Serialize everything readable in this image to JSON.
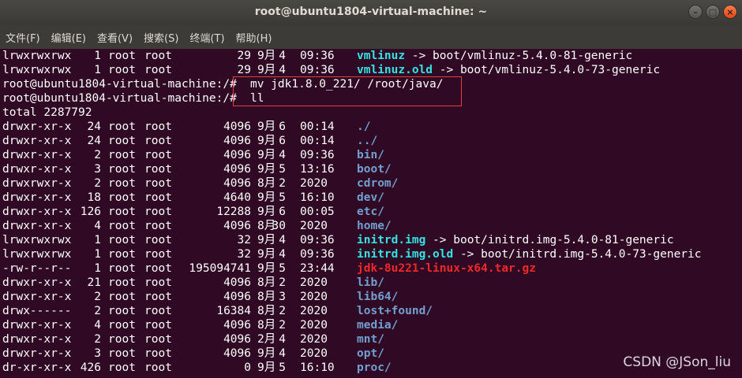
{
  "window": {
    "title": "root@ubuntu1804-virtual-machine: ~"
  },
  "menu": [
    "文件(F)",
    "编辑(E)",
    "查看(V)",
    "搜索(S)",
    "终端(T)",
    "帮助(H)"
  ],
  "rows": [
    {
      "perm": "lrwxrwxrwx",
      "links": "1",
      "user": "root",
      "group": "root",
      "size": "29",
      "month": "9月",
      "day": "4",
      "time": "09:36",
      "name": "vmlinuz",
      "link": " -> boot/vmlinuz-5.4.0-81-generic",
      "color": "cyan"
    },
    {
      "perm": "lrwxrwxrwx",
      "links": "1",
      "user": "root",
      "group": "root",
      "size": "29",
      "month": "9月",
      "day": "4",
      "time": "09:36",
      "name": "vmlinuz.old",
      "link": " -> boot/vmlinuz-5.4.0-73-generic",
      "color": "cyan"
    },
    {
      "prompt": "root@ubuntu1804-virtual-machine:/# ",
      "cmd": "mv jdk1.8.0_221/ /root/java/"
    },
    {
      "prompt": "root@ubuntu1804-virtual-machine:/# ",
      "cmd": "ll"
    },
    {
      "text": "total 2287792"
    },
    {
      "perm": "drwxr-xr-x",
      "links": "24",
      "user": "root",
      "group": "root",
      "size": "4096",
      "month": "9月",
      "day": "6",
      "time": "00:14",
      "name": "./",
      "color": "blue"
    },
    {
      "perm": "drwxr-xr-x",
      "links": "24",
      "user": "root",
      "group": "root",
      "size": "4096",
      "month": "9月",
      "day": "6",
      "time": "00:14",
      "name": "../",
      "color": "blue"
    },
    {
      "perm": "drwxr-xr-x",
      "links": "2",
      "user": "root",
      "group": "root",
      "size": "4096",
      "month": "9月",
      "day": "4",
      "time": "09:36",
      "name": "bin/",
      "color": "blue"
    },
    {
      "perm": "drwxr-xr-x",
      "links": "3",
      "user": "root",
      "group": "root",
      "size": "4096",
      "month": "9月",
      "day": "5",
      "time": "13:16",
      "name": "boot/",
      "color": "blue"
    },
    {
      "perm": "drwxrwxr-x",
      "links": "2",
      "user": "root",
      "group": "root",
      "size": "4096",
      "month": "8月",
      "day": "2",
      "time": "2020",
      "name": "cdrom/",
      "color": "blue"
    },
    {
      "perm": "drwxr-xr-x",
      "links": "18",
      "user": "root",
      "group": "root",
      "size": "4640",
      "month": "9月",
      "day": "5",
      "time": "16:10",
      "name": "dev/",
      "color": "blue"
    },
    {
      "perm": "drwxr-xr-x",
      "links": "126",
      "user": "root",
      "group": "root",
      "size": "12288",
      "month": "9月",
      "day": "6",
      "time": "00:05",
      "name": "etc/",
      "color": "blue"
    },
    {
      "perm": "drwxr-xr-x",
      "links": "4",
      "user": "root",
      "group": "root",
      "size": "4096",
      "month": "8月",
      "day": "30",
      "time": "2020",
      "name": "home/",
      "color": "blue"
    },
    {
      "perm": "lrwxrwxrwx",
      "links": "1",
      "user": "root",
      "group": "root",
      "size": "32",
      "month": "9月",
      "day": "4",
      "time": "09:36",
      "name": "initrd.img",
      "link": " -> boot/initrd.img-5.4.0-81-generic",
      "color": "cyan"
    },
    {
      "perm": "lrwxrwxrwx",
      "links": "1",
      "user": "root",
      "group": "root",
      "size": "32",
      "month": "9月",
      "day": "4",
      "time": "09:36",
      "name": "initrd.img.old",
      "link": " -> boot/initrd.img-5.4.0-73-generic",
      "color": "cyan"
    },
    {
      "perm": "-rw-r--r--",
      "links": "1",
      "user": "root",
      "group": "root",
      "size": "195094741",
      "month": "9月",
      "day": "5",
      "time": "23:44",
      "name": "jdk-8u221-linux-x64.tar.gz",
      "color": "red"
    },
    {
      "perm": "drwxr-xr-x",
      "links": "21",
      "user": "root",
      "group": "root",
      "size": "4096",
      "month": "8月",
      "day": "2",
      "time": "2020",
      "name": "lib/",
      "color": "blue"
    },
    {
      "perm": "drwxr-xr-x",
      "links": "2",
      "user": "root",
      "group": "root",
      "size": "4096",
      "month": "8月",
      "day": "3",
      "time": "2020",
      "name": "lib64/",
      "color": "blue"
    },
    {
      "perm": "drwx------",
      "links": "2",
      "user": "root",
      "group": "root",
      "size": "16384",
      "month": "8月",
      "day": "2",
      "time": "2020",
      "name": "lost+found/",
      "color": "blue"
    },
    {
      "perm": "drwxr-xr-x",
      "links": "4",
      "user": "root",
      "group": "root",
      "size": "4096",
      "month": "8月",
      "day": "2",
      "time": "2020",
      "name": "media/",
      "color": "blue"
    },
    {
      "perm": "drwxr-xr-x",
      "links": "2",
      "user": "root",
      "group": "root",
      "size": "4096",
      "month": "2月",
      "day": "4",
      "time": "2020",
      "name": "mnt/",
      "color": "blue"
    },
    {
      "perm": "drwxr-xr-x",
      "links": "3",
      "user": "root",
      "group": "root",
      "size": "4096",
      "month": "9月",
      "day": "4",
      "time": "2020",
      "name": "opt/",
      "color": "blue"
    },
    {
      "perm": "dr-xr-xr-x",
      "links": "426",
      "user": "root",
      "group": "root",
      "size": "0",
      "month": "9月",
      "day": "5",
      "time": "16:10",
      "name": "proc/",
      "color": "blue"
    }
  ],
  "watermark": "CSDN @JSon_liu",
  "colors": {
    "background": "#300a24",
    "dir": "#729fcf",
    "link": "#34e2e2",
    "archive": "#ef2929",
    "highlight_box": "#e04040"
  }
}
